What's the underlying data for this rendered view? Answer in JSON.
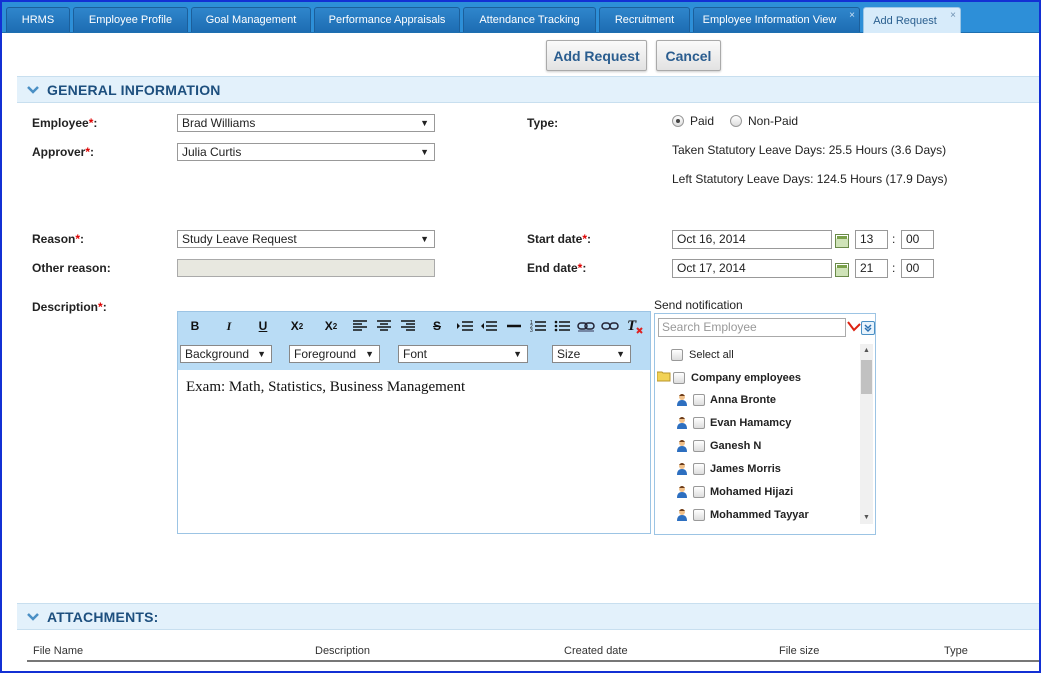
{
  "tabs": [
    {
      "label": "HRMS"
    },
    {
      "label": "Employee Profile"
    },
    {
      "label": "Goal Management"
    },
    {
      "label": "Performance Appraisals"
    },
    {
      "label": "Attendance Tracking"
    },
    {
      "label": "Recruitment"
    },
    {
      "label": "Employee Information View"
    },
    {
      "label": "Add Request"
    }
  ],
  "tab_close": "×",
  "actions": {
    "add": "Add Request",
    "cancel": "Cancel"
  },
  "general": {
    "title": "GENERAL INFORMATION",
    "required_mark": "*",
    "employee_label": "Employee",
    "employee_value": "Brad Williams",
    "approver_label": "Approver",
    "approver_value": "Julia Curtis",
    "type_label": "Type:",
    "type_options": [
      "Paid",
      "Non-Paid"
    ],
    "type_selected": "Paid",
    "taken_leave": "Taken Statutory Leave Days: 25.5 Hours (3.6 Days)",
    "left_leave": "Left Statutory Leave Days: 124.5 Hours (17.9 Days)",
    "reason_label": "Reason",
    "reason_value": "Study Leave Request",
    "other_reason_label": "Other reason:",
    "start_label": "Start date",
    "start_date": "Oct 16, 2014",
    "start_hour": "13",
    "start_min": "00",
    "end_label": "End date",
    "end_date": "Oct 17, 2014",
    "end_hour": "21",
    "end_min": "00",
    "time_sep": ":",
    "description_label": "Description",
    "colon": ":"
  },
  "editor": {
    "selects": {
      "background": "Background",
      "foreground": "Foreground",
      "font": "Font",
      "size": "Size"
    },
    "content": "Exam: Math, Statistics, Business Management"
  },
  "notification": {
    "title": "Send notification",
    "search_placeholder": "Search Employee",
    "select_all": "Select all",
    "group": "Company employees",
    "employees": [
      "Anna Bronte",
      "Evan Hamamcy",
      "Ganesh N",
      "James Morris",
      "Mohamed Hijazi",
      "Mohammed Tayyar"
    ]
  },
  "attachments": {
    "title": "ATTACHMENTS:",
    "columns": [
      "File Name",
      "Description",
      "Created date",
      "File size",
      "Type"
    ]
  },
  "colors": {
    "accent": "#2d8fd8",
    "section_bg": "#e3f1fb",
    "required": "#dd0000"
  }
}
